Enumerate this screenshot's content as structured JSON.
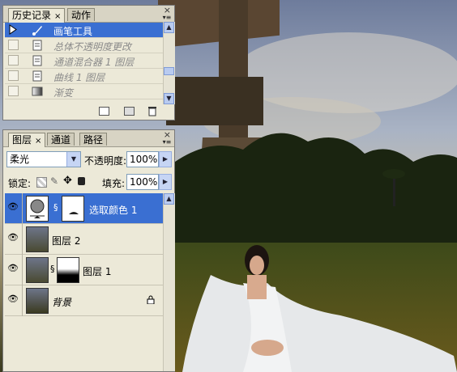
{
  "history_panel": {
    "tabs": [
      {
        "label": "历史记录",
        "close": "×"
      },
      {
        "label": "动作"
      }
    ],
    "close_glyph": "×",
    "items": [
      {
        "label": "画笔工具",
        "icon": "brush-icon",
        "selected": true
      },
      {
        "label": "总体不透明度更改",
        "icon": "document-icon"
      },
      {
        "label": "通道混合器 1 图层",
        "icon": "document-icon"
      },
      {
        "label": "曲线 1 图层",
        "icon": "document-icon"
      },
      {
        "label": "渐变",
        "icon": "gradient-icon"
      }
    ],
    "footer_icons": [
      "new-snapshot-icon",
      "camera-icon",
      "trash-icon"
    ]
  },
  "layers_panel": {
    "tabs": [
      {
        "label": "图层",
        "close": "×"
      },
      {
        "label": "通道"
      },
      {
        "label": "路径"
      }
    ],
    "close_glyph": "×",
    "blend_mode": "柔光",
    "opacity_label": "不透明度:",
    "opacity_value": "100%",
    "lock_label": "锁定:",
    "fill_label": "填充:",
    "fill_value": "100%",
    "layers": [
      {
        "name": "选取颜色 1",
        "selected": true,
        "type": "adjustment"
      },
      {
        "name": "图层 2"
      },
      {
        "name": "图层 1",
        "has_mask": true
      },
      {
        "name": "背景",
        "locked": true,
        "italic": true
      }
    ]
  },
  "colors": {
    "selection": "#3a6fd2",
    "panel_bg": "#ece9d8"
  }
}
